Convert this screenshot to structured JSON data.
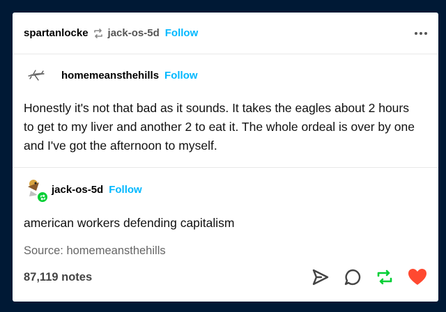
{
  "header": {
    "reblogger": "spartanlocke",
    "reblogged_from": "jack-os-5d",
    "follow_label": "Follow"
  },
  "original_post": {
    "author": "homemeansthehills",
    "follow_label": "Follow",
    "text": "Honestly it's not that bad as it sounds. It takes the eagles about 2 hours to get to my liver and another 2 to eat it. The whole ordeal is over by one and I've got the afternoon to myself."
  },
  "reblog_post": {
    "author": "jack-os-5d",
    "follow_label": "Follow",
    "text": "american workers defending capitalism",
    "source": "Source: homemeansthehills"
  },
  "footer": {
    "notes": "87,119 notes"
  },
  "colors": {
    "background": "#001935",
    "follow": "#00b8ff",
    "reblog": "#00cf35",
    "like": "#ff4930"
  }
}
